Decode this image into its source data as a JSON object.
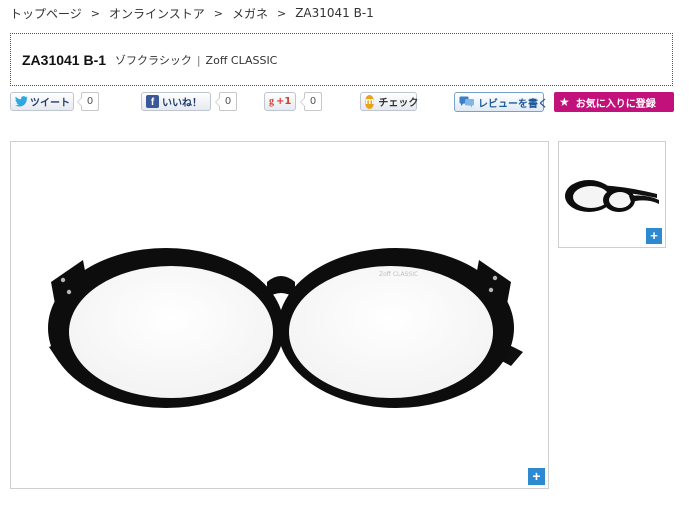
{
  "breadcrumb": {
    "items": [
      "トップページ",
      "オンラインストア",
      "メガネ",
      "ZA31041 B-1"
    ],
    "separator": ">"
  },
  "product": {
    "code": "ZA31041 B-1",
    "series_jp": "ゾフクラシック",
    "series_sep": "|",
    "series_en": "Zoff CLASSIC",
    "temple_print": "Zoff CLASSIC"
  },
  "social": {
    "tweet_label": "ツイート",
    "tweet_count": "0",
    "like_label": "いいね！",
    "like_count": "0",
    "gplus_label": "+1",
    "gplus_count": "0",
    "check_label": "チェック",
    "review_label": "レビューを書く",
    "favorite_label": "お気に入りに登録"
  },
  "gallery": {
    "zoom_symbol": "+",
    "thumbnail_zoom_symbol": "+"
  },
  "colors": {
    "favorite_button": "#c3117c",
    "zoom_button": "#2e8ad0",
    "facebook": "#3b5998",
    "google_plus": "#d73d32",
    "mixi": "#e8a317",
    "frame": "#0d0d0d"
  },
  "icons": {
    "tweet": "twitter-bird-icon",
    "like": "facebook-f-icon",
    "gplus": "google-plus-icon",
    "check": "mixi-check-icon",
    "review": "speech-bubble-icon",
    "favorite": "star-icon",
    "zoom": "plus-icon"
  }
}
